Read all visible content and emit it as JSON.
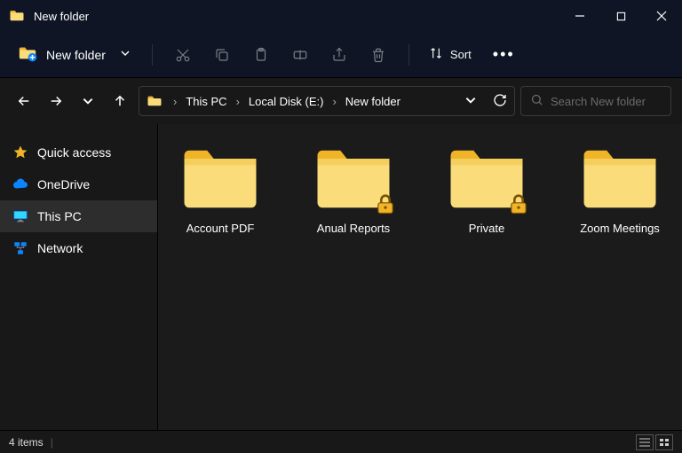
{
  "window": {
    "title": "New folder"
  },
  "toolbar": {
    "new_label": "New folder",
    "sort_label": "Sort"
  },
  "breadcrumb": {
    "items": [
      "This PC",
      "Local Disk (E:)",
      "New folder"
    ]
  },
  "search": {
    "placeholder": "Search New folder"
  },
  "sidebar": {
    "items": [
      {
        "label": "Quick access",
        "icon": "star",
        "selected": false
      },
      {
        "label": "OneDrive",
        "icon": "cloud",
        "selected": false
      },
      {
        "label": "This PC",
        "icon": "monitor",
        "selected": true
      },
      {
        "label": "Network",
        "icon": "network",
        "selected": false
      }
    ]
  },
  "folders": [
    {
      "name": "Account PDF",
      "locked": false
    },
    {
      "name": "Anual Reports",
      "locked": true
    },
    {
      "name": "Private",
      "locked": true
    },
    {
      "name": "Zoom Meetings",
      "locked": false
    }
  ],
  "status": {
    "count_text": "4 items"
  },
  "colors": {
    "folder_main": "#fadd7a",
    "folder_tab": "#f0b429",
    "accent_blue": "#0a84ff"
  }
}
